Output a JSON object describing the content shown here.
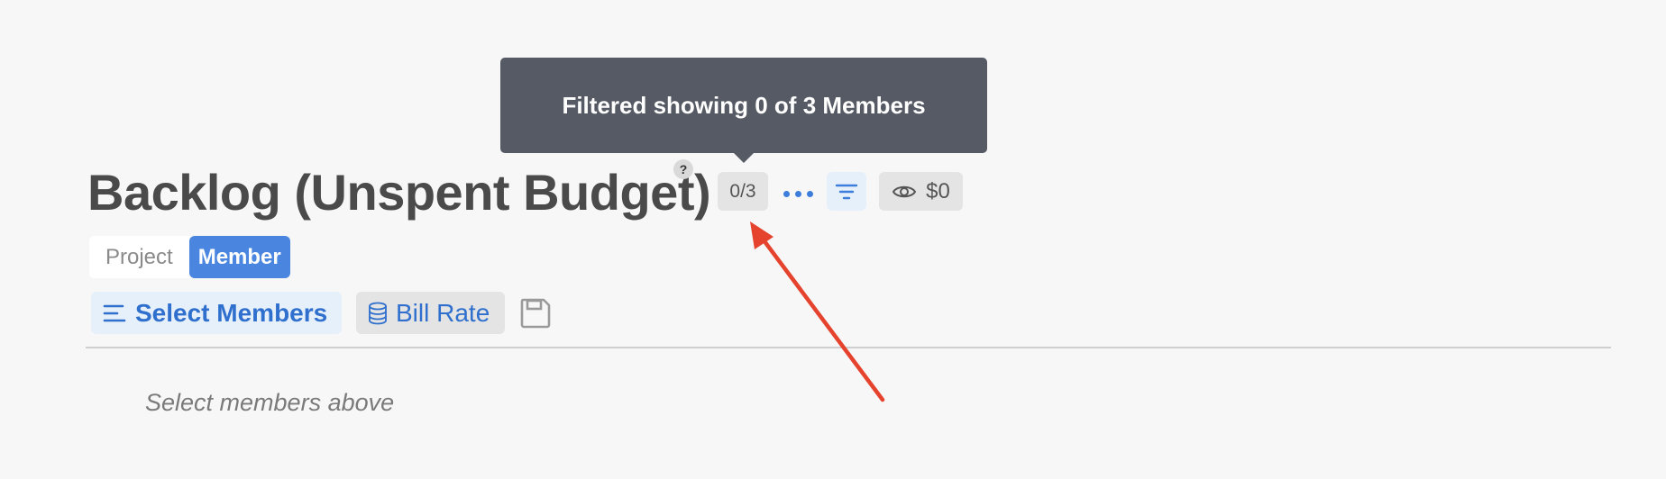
{
  "tooltip": {
    "text": "Filtered showing 0 of 3 Members"
  },
  "header": {
    "title": "Backlog (Unspent Budget)",
    "help_glyph": "?",
    "count_label": "0/3",
    "eye_value": "$0"
  },
  "view_toggle": {
    "options": [
      "Project",
      "Member"
    ],
    "selected": "Member"
  },
  "actions": {
    "select_members_label": "Select Members",
    "bill_rate_label": "Bill Rate"
  },
  "content": {
    "empty_hint": "Select members above"
  },
  "colors": {
    "accent": "#4a86e0",
    "link_blue": "#2f6fcd",
    "tooltip_bg": "#555a64",
    "annotation_red": "#e5432d"
  },
  "icons": {
    "more": "more-dots-icon",
    "filter": "filter-icon",
    "eye": "eye-icon",
    "select_members": "list-lines-icon",
    "bill_rate": "database-icon",
    "save": "save-icon"
  }
}
